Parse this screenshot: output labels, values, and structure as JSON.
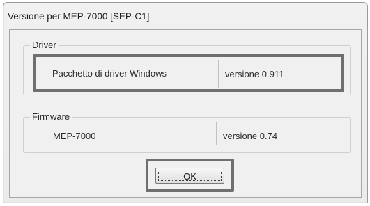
{
  "window": {
    "title": "Versione per MEP-7000 [SEP-C1]"
  },
  "driver_group": {
    "legend": "Driver",
    "name": "Pacchetto di driver Windows",
    "version": "versione 0.911"
  },
  "firmware_group": {
    "legend": "Firmware",
    "name": "MEP-7000",
    "version": "versione 0.74"
  },
  "buttons": {
    "ok_label": "OK"
  }
}
